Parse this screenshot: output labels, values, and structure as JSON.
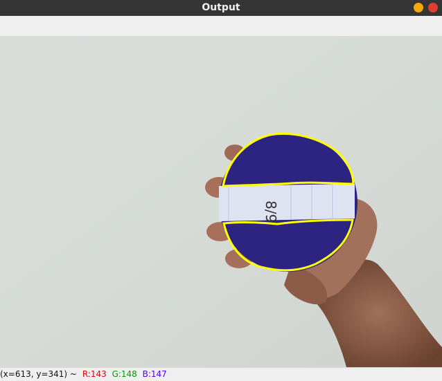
{
  "window": {
    "title": "Output",
    "controls": {
      "minimize_icon": "minimize-icon",
      "close_icon": "close-icon",
      "minimize_color": "#f4a90b",
      "close_color": "#e03e30"
    }
  },
  "status": {
    "coords": "(x=613, y=341) ~",
    "r": "R:143",
    "g": "G:148",
    "b": "B:147",
    "r_color": "#e60000",
    "g_color": "#009b00",
    "b_color": "#5a00e6"
  },
  "image": {
    "contour_color": "#ffff00",
    "disc_color": "#2d2380",
    "strip_text": "8/9"
  }
}
